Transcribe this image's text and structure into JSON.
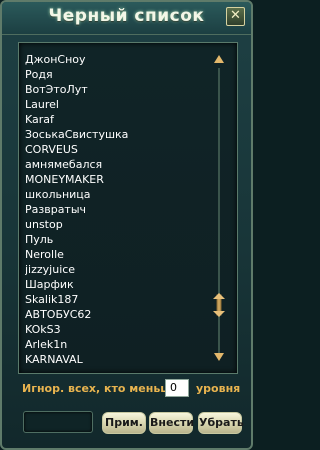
{
  "window": {
    "title": "Черный список",
    "close_symbol": "✕"
  },
  "blacklist": {
    "items": [
      "ДжонСноу",
      "Родя",
      "ВотЭтоЛут",
      "Laurel",
      "Karaf",
      "ЗоськаСвистушка",
      "CORVEUS",
      "амнямебался",
      "MONEYMAKER",
      "школьница",
      "Развратыч",
      "unstop",
      "Пуль",
      "Nerolle",
      "jizzyjuice",
      "Шарфик",
      "Skalik187",
      "АВТОБУС62",
      "KOkS3",
      "Arlek1n",
      "KARNAVAL"
    ]
  },
  "filter": {
    "label": "Игнор. всех, кто меньше:",
    "level_value": "0",
    "unit_label": "уровня"
  },
  "controls": {
    "name_value": "",
    "apply_label": "Прим.",
    "add_label": "Внести",
    "remove_label": "Убрать"
  },
  "colors": {
    "accent": "#e9b44f",
    "panel": "#183538",
    "text": "#ffffff"
  }
}
